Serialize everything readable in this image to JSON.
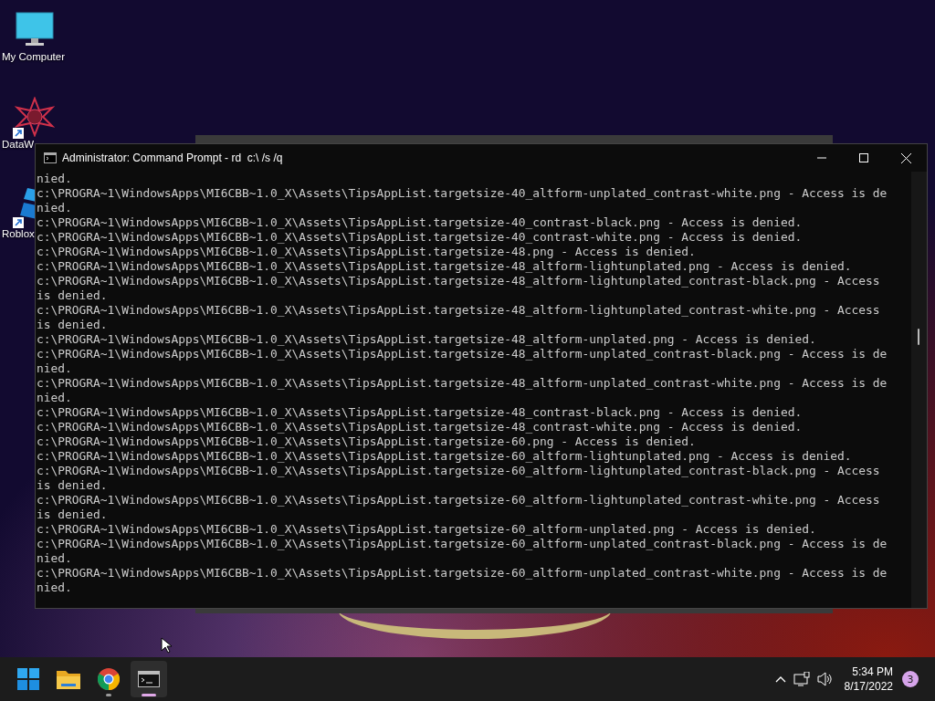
{
  "desktop_icons": [
    {
      "kind": "monitor",
      "label": "My Computer",
      "shortcut": false
    },
    {
      "kind": "star",
      "label": "DataW",
      "shortcut": true
    },
    {
      "kind": "roblox",
      "label": "Roblox",
      "shortcut": true
    }
  ],
  "window": {
    "title": "Administrator: Command Prompt - rd  c:\\ /s /q",
    "lines": [
      "nied.",
      "c:\\PROGRA~1\\WindowsApps\\MI6CBB~1.0_X\\Assets\\TipsAppList.targetsize-40_altform-unplated_contrast-white.png - Access is de",
      "nied.",
      "c:\\PROGRA~1\\WindowsApps\\MI6CBB~1.0_X\\Assets\\TipsAppList.targetsize-40_contrast-black.png - Access is denied.",
      "c:\\PROGRA~1\\WindowsApps\\MI6CBB~1.0_X\\Assets\\TipsAppList.targetsize-40_contrast-white.png - Access is denied.",
      "c:\\PROGRA~1\\WindowsApps\\MI6CBB~1.0_X\\Assets\\TipsAppList.targetsize-48.png - Access is denied.",
      "c:\\PROGRA~1\\WindowsApps\\MI6CBB~1.0_X\\Assets\\TipsAppList.targetsize-48_altform-lightunplated.png - Access is denied.",
      "c:\\PROGRA~1\\WindowsApps\\MI6CBB~1.0_X\\Assets\\TipsAppList.targetsize-48_altform-lightunplated_contrast-black.png - Access",
      "is denied.",
      "c:\\PROGRA~1\\WindowsApps\\MI6CBB~1.0_X\\Assets\\TipsAppList.targetsize-48_altform-lightunplated_contrast-white.png - Access",
      "is denied.",
      "c:\\PROGRA~1\\WindowsApps\\MI6CBB~1.0_X\\Assets\\TipsAppList.targetsize-48_altform-unplated.png - Access is denied.",
      "c:\\PROGRA~1\\WindowsApps\\MI6CBB~1.0_X\\Assets\\TipsAppList.targetsize-48_altform-unplated_contrast-black.png - Access is de",
      "nied.",
      "c:\\PROGRA~1\\WindowsApps\\MI6CBB~1.0_X\\Assets\\TipsAppList.targetsize-48_altform-unplated_contrast-white.png - Access is de",
      "nied.",
      "c:\\PROGRA~1\\WindowsApps\\MI6CBB~1.0_X\\Assets\\TipsAppList.targetsize-48_contrast-black.png - Access is denied.",
      "c:\\PROGRA~1\\WindowsApps\\MI6CBB~1.0_X\\Assets\\TipsAppList.targetsize-48_contrast-white.png - Access is denied.",
      "c:\\PROGRA~1\\WindowsApps\\MI6CBB~1.0_X\\Assets\\TipsAppList.targetsize-60.png - Access is denied.",
      "c:\\PROGRA~1\\WindowsApps\\MI6CBB~1.0_X\\Assets\\TipsAppList.targetsize-60_altform-lightunplated.png - Access is denied.",
      "c:\\PROGRA~1\\WindowsApps\\MI6CBB~1.0_X\\Assets\\TipsAppList.targetsize-60_altform-lightunplated_contrast-black.png - Access",
      "is denied.",
      "c:\\PROGRA~1\\WindowsApps\\MI6CBB~1.0_X\\Assets\\TipsAppList.targetsize-60_altform-lightunplated_contrast-white.png - Access",
      "is denied.",
      "c:\\PROGRA~1\\WindowsApps\\MI6CBB~1.0_X\\Assets\\TipsAppList.targetsize-60_altform-unplated.png - Access is denied.",
      "c:\\PROGRA~1\\WindowsApps\\MI6CBB~1.0_X\\Assets\\TipsAppList.targetsize-60_altform-unplated_contrast-black.png - Access is de",
      "nied.",
      "c:\\PROGRA~1\\WindowsApps\\MI6CBB~1.0_X\\Assets\\TipsAppList.targetsize-60_altform-unplated_contrast-white.png - Access is de",
      "nied."
    ]
  },
  "taskbar": {
    "apps": [
      {
        "kind": "start",
        "running": false,
        "selected": false
      },
      {
        "kind": "folder",
        "running": false,
        "selected": false
      },
      {
        "kind": "browser",
        "running": true,
        "selected": false
      },
      {
        "kind": "terminal",
        "running": true,
        "selected": true
      }
    ],
    "time": "5:34 PM",
    "date": "8/17/2022",
    "notifications": "3"
  }
}
